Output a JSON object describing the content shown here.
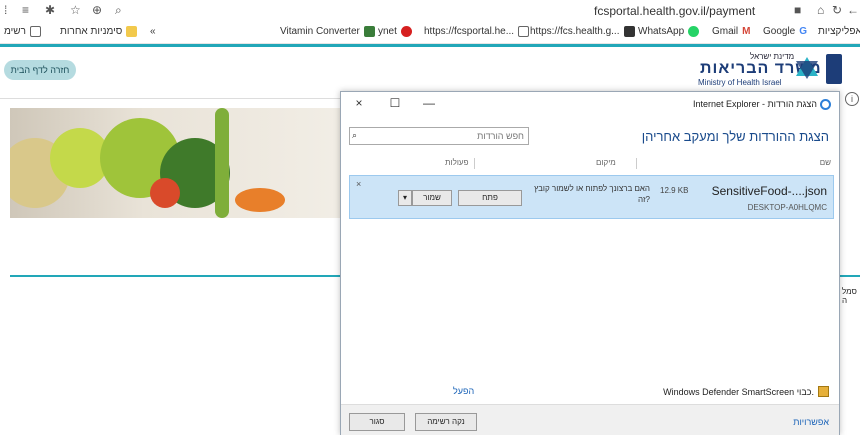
{
  "browser": {
    "url": "fcsportal.health.gov.il/payment",
    "bookmarks": [
      {
        "label": "אפליקציות",
        "icon": "apps-icon"
      },
      {
        "label": "Google",
        "icon": "google-icon"
      },
      {
        "label": "Gmail",
        "icon": "gmail-icon"
      },
      {
        "label": "WhatsApp",
        "icon": "whatsapp-icon"
      },
      {
        "label": "https://fcs.health.g...",
        "icon": "angular-icon"
      },
      {
        "label": "https://fcsportal.he...",
        "icon": "page-icon"
      },
      {
        "label": "ynet",
        "icon": "ynet-icon"
      },
      {
        "label": "Vitamin Converter",
        "icon": "vitamin-icon"
      },
      {
        "label": "סימניות אחרות",
        "icon": "folder-icon"
      },
      {
        "label": "רשימ",
        "icon": "reading-list-icon"
      }
    ],
    "bookmark_more": "«"
  },
  "page": {
    "return_button": "חזרה לדף הבית",
    "logo": {
      "top": "מדינת ישראל",
      "hebrew": "משרד הבריאות",
      "english": "Ministry of Health Israel"
    },
    "info_icon": "i",
    "side_text": "סמל ה"
  },
  "dialog": {
    "title": "Internet Explorer - הצגת הורדות",
    "heading": "הצגת ההורדות שלך ומעקב אחריהן",
    "search_placeholder": "חפש הורדות",
    "columns": {
      "name": "שם",
      "location": "מיקום",
      "actions": "פעולות"
    },
    "download": {
      "filename": "SensitiveFood-....json",
      "source": "DESKTOP-A0HLQMC",
      "size": "12.9 KB",
      "question": "האם ברצונך לפתוח או לשמור קובץ זה?",
      "open_label": "פתח",
      "save_label": "שמור",
      "dropdown_label": "▾",
      "dismiss": "×"
    },
    "smartscreen": "Windows Defender SmartScreen כבוי.",
    "smartscreen_link": "הפעל",
    "options_link": "אפשרויות",
    "clear_list": "נקה רשימה",
    "close": "סגור",
    "window_buttons": {
      "close": "×",
      "maximize": "☐",
      "minimize": "—"
    }
  },
  "colors": {
    "accent": "#22a7b8",
    "selection": "#cce4f7",
    "link": "#1a63b8"
  }
}
